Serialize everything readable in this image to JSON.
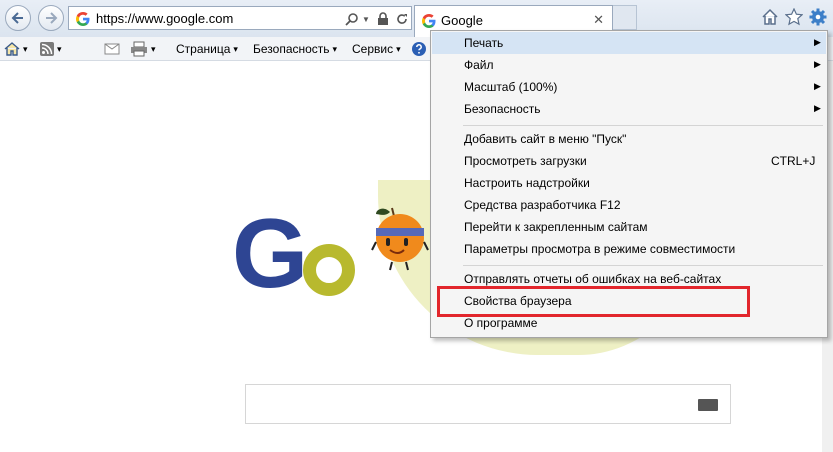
{
  "browser": {
    "address_url": "https://www.google.com",
    "tab_title": "Google",
    "tab_close": "✕"
  },
  "command_bar": {
    "page_label": "Страница",
    "safety_label": "Безопасность",
    "tools_label": "Сервис",
    "caret": "▾"
  },
  "menu": {
    "items": [
      {
        "label": "Печать",
        "submenu": true,
        "shortcut": ""
      },
      {
        "label": "Файл",
        "submenu": true,
        "shortcut": ""
      },
      {
        "label": "Масштаб (100%)",
        "submenu": true,
        "shortcut": ""
      },
      {
        "label": "Безопасность",
        "submenu": true,
        "shortcut": ""
      },
      {
        "label": "Добавить сайт в меню \"Пуск\"",
        "submenu": false,
        "shortcut": ""
      },
      {
        "label": "Просмотреть загрузки",
        "submenu": false,
        "shortcut": "CTRL+J"
      },
      {
        "label": "Настроить надстройки",
        "submenu": false,
        "shortcut": ""
      },
      {
        "label": "Средства разработчика F12",
        "submenu": false,
        "shortcut": ""
      },
      {
        "label": "Перейти к закрепленным сайтам",
        "submenu": false,
        "shortcut": ""
      },
      {
        "label": "Параметры просмотра в режиме совместимости",
        "submenu": false,
        "shortcut": ""
      },
      {
        "label": "Отправлять отчеты об ошибках на веб-сайтах",
        "submenu": false,
        "shortcut": ""
      },
      {
        "label": "Свойства браузера",
        "submenu": false,
        "shortcut": ""
      },
      {
        "label": "О программе",
        "submenu": false,
        "shortcut": ""
      }
    ],
    "arrow": "▶"
  },
  "colors": {
    "highlight_box": "#e2262c",
    "google_blue": "#2e4593",
    "google_olive": "#b8b92e",
    "doodle_yellow": "#eef0c4"
  }
}
